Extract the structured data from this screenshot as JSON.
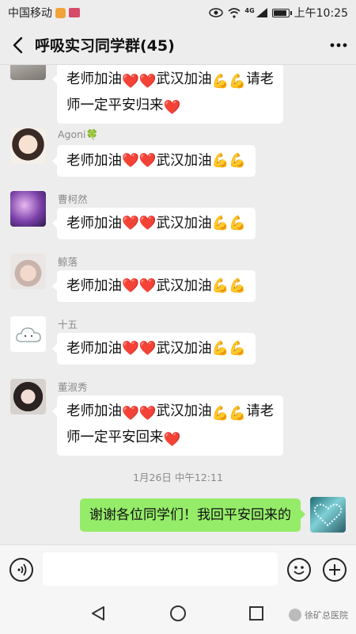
{
  "status_bar": {
    "carrier": "中国移动",
    "network": "4G",
    "time": "上午10:25"
  },
  "header": {
    "title": "呼吸实习同学群(45)",
    "back_icon": "chevron-left-icon",
    "more_icon": "more-dots-icon"
  },
  "messages": [
    {
      "sender": "",
      "text": "老师加油❤️❤️武汉加油💪💪请老师一定平安归来❤️",
      "lines": [
        "老师加油",
        "师一定平安归来"
      ]
    },
    {
      "sender": "Agoni🍀",
      "text": "老师加油❤️❤️武汉加油💪💪"
    },
    {
      "sender": "曹柯然",
      "text": "老师加油❤️❤️武汉加油💪💪"
    },
    {
      "sender": "鲸落",
      "text": "老师加油❤️❤️武汉加油💪💪"
    },
    {
      "sender": "十五",
      "text": "老师加油❤️❤️武汉加油💪💪"
    },
    {
      "sender": "董淑秀",
      "text": "老师加油❤️❤️武汉加油💪💪请老师一定平安回来❤️"
    }
  ],
  "timestamp": "1月26日 中午12:11",
  "self_message": {
    "text": "谢谢各位同学们！我回平安回来的"
  },
  "input_bar": {
    "voice_icon": "voice-icon",
    "emoji_icon": "emoji-icon",
    "plus_icon": "plus-icon"
  },
  "watermark": "徐矿总医院",
  "colors": {
    "background": "#ededed",
    "self_bubble": "#95ec69",
    "other_bubble": "#ffffff",
    "heart": "#f0522e"
  }
}
